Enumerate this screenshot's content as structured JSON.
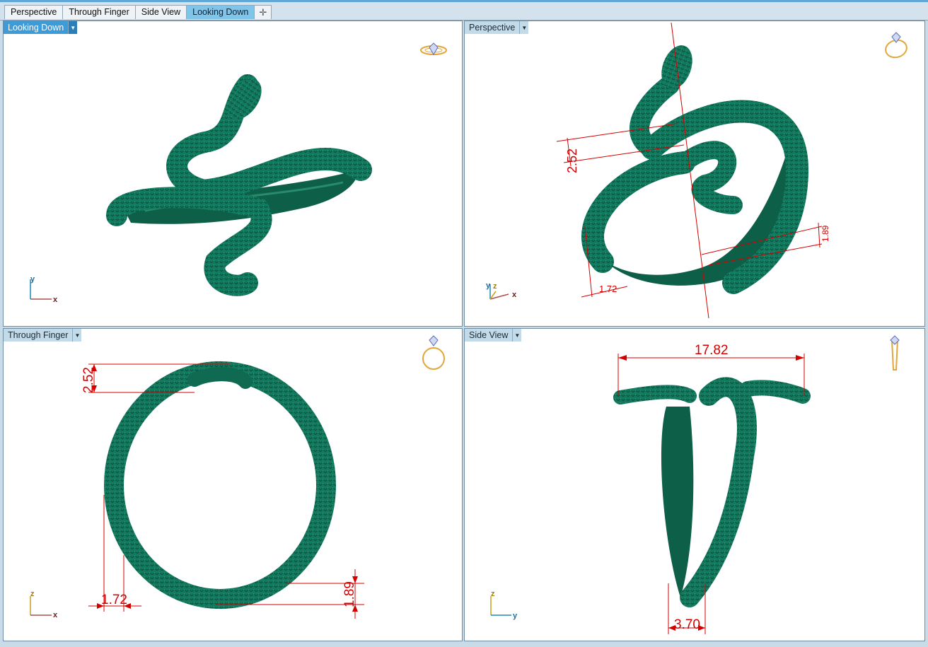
{
  "tabs": [
    {
      "label": "Perspective",
      "active": false
    },
    {
      "label": "Through Finger",
      "active": false
    },
    {
      "label": "Side View",
      "active": false
    },
    {
      "label": "Looking Down",
      "active": true
    }
  ],
  "add_tab_symbol": "✛",
  "viewports": {
    "top_left": {
      "label": "Looking Down",
      "axes": {
        "vertical": "y",
        "horizontal": "x"
      },
      "widget_icon": "ring-top-icon"
    },
    "top_right": {
      "label": "Perspective",
      "axes": {
        "vertical": "y",
        "depth": "z",
        "horizontal": "x"
      },
      "dimensions": [
        "2.52",
        "1.89",
        "1.72"
      ],
      "widget_icon": "ring-perspective-icon"
    },
    "bottom_left": {
      "label": "Through Finger",
      "axes": {
        "vertical": "z",
        "horizontal": "x"
      },
      "dimensions": {
        "top": "2.52",
        "left": "1.72",
        "right": "1.89"
      },
      "widget_icon": "ring-front-icon"
    },
    "bottom_right": {
      "label": "Side View",
      "axes": {
        "vertical": "z",
        "horizontal": "y"
      },
      "dimensions": {
        "top": "17.82",
        "bottom": "3.70"
      },
      "widget_icon": "ring-side-icon"
    }
  },
  "colors": {
    "model": "#0f6e55",
    "dimension": "#d40000",
    "active_tab": "#7fc4e9",
    "active_label": "#3d9bd8"
  }
}
